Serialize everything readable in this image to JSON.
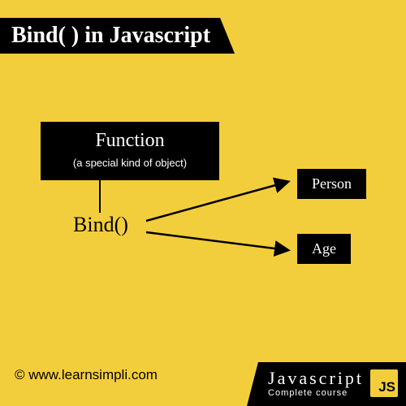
{
  "title": "Bind( ) in Javascript",
  "function_box": {
    "heading": "Function",
    "subtitle": "(a special kind of object)"
  },
  "bind_label": "Bind()",
  "targets": [
    "Person",
    "Age"
  ],
  "footer": {
    "credit": "© www.learnsimpli.com",
    "brand_title": "Javascript",
    "brand_sub": "Complete course",
    "js_badge": "JS"
  }
}
